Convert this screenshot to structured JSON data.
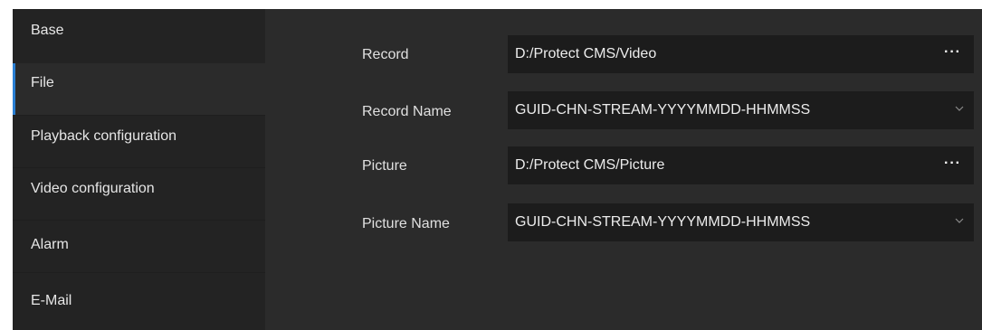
{
  "sidebar": {
    "items": [
      {
        "label": "Base"
      },
      {
        "label": "File"
      },
      {
        "label": "Playback configuration"
      },
      {
        "label": "Video configuration"
      },
      {
        "label": "Alarm"
      },
      {
        "label": "E-Mail"
      }
    ],
    "active_index": 1
  },
  "form": {
    "record": {
      "label": "Record",
      "value": "D:/Protect CMS/Video",
      "button_icon": "more-dots-icon"
    },
    "record_name": {
      "label": "Record Name",
      "value": "GUID-CHN-STREAM-YYYYMMDD-HHMMSS",
      "button_icon": "chevron-down-icon"
    },
    "picture": {
      "label": "Picture",
      "value": "D:/Protect CMS/Picture",
      "button_icon": "more-dots-icon"
    },
    "picture_name": {
      "label": "Picture Name",
      "value": "GUID-CHN-STREAM-YYYYMMDD-HHMMSS",
      "button_icon": "chevron-down-icon"
    }
  },
  "colors": {
    "accent": "#2a7fd4",
    "panel": "#2b2b2b",
    "sidebar": "#232323",
    "field": "#1c1c1c"
  }
}
